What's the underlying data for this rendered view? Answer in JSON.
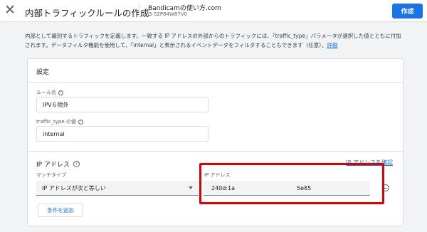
{
  "header": {
    "title": "内部トラフィックルールの作成",
    "property_name": "Bandicamの使い方.com",
    "property_id": "G-52P84W87V0",
    "create_label": "作成",
    "close_icon": "close-icon"
  },
  "intro": {
    "text": "内部として識別するトラフィックを定義します。一致する IP アドレスの外部からのトラフィックには、「traffic_type」パラメータが選択した値とともに付加されます。データフィルタ機能を使用して、「internal」と表示されるイベントデータをフィルタすることもできます（任意）。",
    "link": "詳細"
  },
  "settings": {
    "title": "設定",
    "rule_name_label": "ルール名",
    "rule_name_value": "IPV６除外",
    "traffic_type_label": "traffic_type の値",
    "traffic_type_value": "internal"
  },
  "ip_section": {
    "title": "IP アドレス",
    "confirm_link": "IP アドレスを確認",
    "match_type_label": "マッチタイプ",
    "match_type_value": "IP アドレスが次と等しい",
    "ip_label": "IP アドレス",
    "ip_value_left": "240d:1a",
    "ip_value_right": "5e85",
    "add_condition_label": "条件を追加"
  },
  "colors": {
    "accent": "#1a73e8",
    "highlight": "#e00000"
  }
}
